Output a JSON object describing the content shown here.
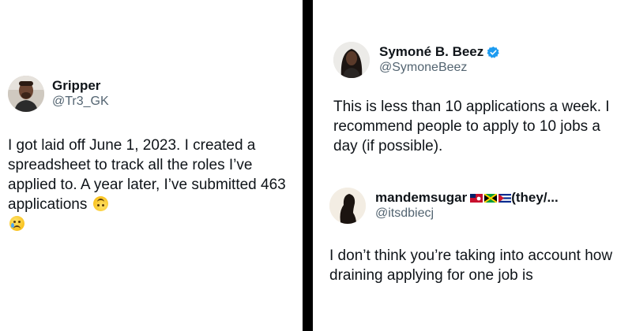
{
  "left_tweet": {
    "display_name": "Gripper",
    "handle": "@Tr3_GK",
    "avatar_icon": "profile-photo-man-icon",
    "text": "I got laid off June 1, 2023. I created a spreadsheet to track all the roles I’ve applied to. A year later, I’ve submitted 463 applications",
    "emojis": [
      "upside-down-face",
      "crying-face"
    ]
  },
  "right_tweet": {
    "display_name": "Symoné B. Beez",
    "handle": "@SymoneBeez",
    "verified": true,
    "avatar_icon": "profile-photo-woman-icon",
    "text": "This is less than 10 applications a week. I recommend people to apply to 10 jobs a day (if possible)."
  },
  "reply_tweet": {
    "display_name_prefix": "mandemsugar",
    "display_name_suffix": "(they/...",
    "flags": [
      "bermuda-flag",
      "jamaica-flag",
      "cuba-flag"
    ],
    "handle": "@itsdbiecj",
    "avatar_icon": "profile-silhouette-icon",
    "text": "I don’t think you’re taking into account how draining applying for one job is"
  },
  "colors": {
    "background": "#ffffff",
    "divider": "#000000",
    "text_primary": "#0f1419",
    "text_secondary": "#536471",
    "verified_blue": "#1d9bf0"
  }
}
